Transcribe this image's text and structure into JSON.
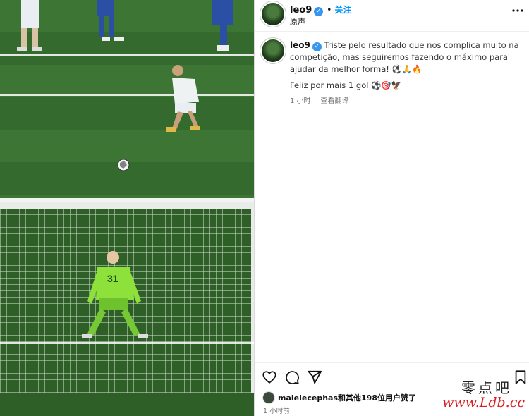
{
  "header": {
    "username": "leo9",
    "verified_mark": "✓",
    "separator": "•",
    "follow_label": "关注",
    "audio_label": "原声",
    "more_icon": "more-horizontal-icon"
  },
  "caption": {
    "username": "leo9",
    "text": "Triste pelo resultado que nos complica muito na competição, mas seguiremos fazendo o máximo para ajudar da melhor forma! ⚽🙏🔥",
    "comment": "Feliz por mais 1 gol ⚽🎯🦅",
    "time_ago": "1 小时",
    "see_translation": "查看翻译"
  },
  "actions": {
    "like_icon": "heart-icon",
    "comment_icon": "comment-icon",
    "share_icon": "send-icon",
    "save_icon": "bookmark-icon"
  },
  "likes": {
    "liker": "malelecephas",
    "rest": "和其他198位用户赞了"
  },
  "posted_time": "1 小时前",
  "watermark": {
    "chinese": "零点吧",
    "url": "www.Ldb.cc"
  }
}
